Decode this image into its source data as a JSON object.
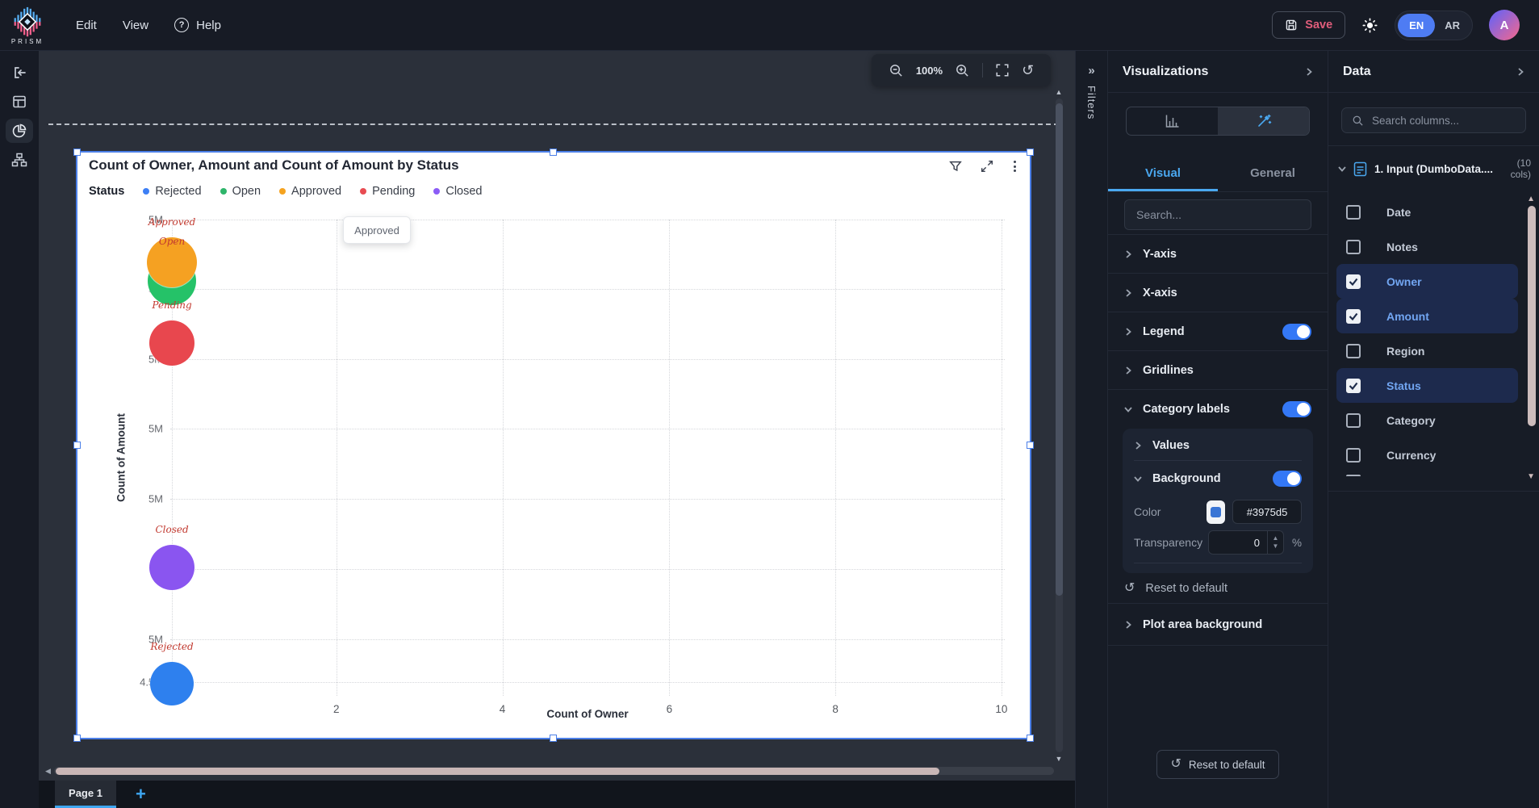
{
  "topbar": {
    "brand": "PRISM",
    "menus": {
      "edit": "Edit",
      "view": "View",
      "help": "Help"
    },
    "save_label": "Save",
    "lang": {
      "en": "EN",
      "ar": "AR"
    },
    "avatar_initial": "A"
  },
  "canvas": {
    "zoom_level": "100%",
    "filters_tab": "Filters",
    "page_tab": "Page 1",
    "add_page": "+",
    "tooltip": "Approved"
  },
  "chart_data": {
    "type": "scatter",
    "title": "Count of Owner, Amount and Count of Amount by Status",
    "xlabel": "Count of Owner",
    "ylabel": "Count of Amount",
    "legend_title": "Status",
    "legend_position": "top",
    "grid": true,
    "x_axis_range": [
      0,
      10
    ],
    "y_axis_range": [
      "4.5M",
      "5.2M"
    ],
    "x_ticks": [
      {
        "label": "",
        "frac": 0.002
      },
      {
        "label": "2",
        "frac": 0.199
      },
      {
        "label": "4",
        "frac": 0.398
      },
      {
        "label": "6",
        "frac": 0.598
      },
      {
        "label": "8",
        "frac": 0.797
      },
      {
        "label": "10",
        "frac": 0.996
      }
    ],
    "y_ticks": [
      {
        "label": "5M",
        "frac": 0.0
      },
      {
        "label": "5M",
        "frac": 0.146
      },
      {
        "label": "5M",
        "frac": 0.293
      },
      {
        "label": "5M",
        "frac": 0.439
      },
      {
        "label": "5M",
        "frac": 0.586
      },
      {
        "label": "",
        "frac": 0.734
      },
      {
        "label": "5M",
        "frac": 0.881
      },
      {
        "label": "4.5M",
        "frac": 0.971
      }
    ],
    "points": [
      {
        "status": "Open",
        "count_of_owner": 0,
        "count_of_amount_M": 5.11,
        "color": "#25c268",
        "fx": 0.002,
        "fy": 0.129,
        "r": 30
      },
      {
        "status": "Approved",
        "count_of_owner": 0,
        "count_of_amount_M": 5.14,
        "color": "#f5a122",
        "fx": 0.002,
        "fy": 0.09,
        "r": 31
      },
      {
        "status": "Pending",
        "count_of_owner": 0,
        "count_of_amount_M": 5.02,
        "color": "#e8474e",
        "fx": 0.002,
        "fy": 0.259,
        "r": 28
      },
      {
        "status": "Closed",
        "count_of_owner": 0,
        "count_of_amount_M": 4.7,
        "color": "#8a55f0",
        "fx": 0.002,
        "fy": 0.731,
        "r": 28
      },
      {
        "status": "Rejected",
        "count_of_owner": 0,
        "count_of_amount_M": 4.54,
        "color": "#2e80ee",
        "fx": 0.002,
        "fy": 0.975,
        "r": 27
      }
    ],
    "legend": [
      {
        "label": "Rejected",
        "color": "#3d7ff5"
      },
      {
        "label": "Open",
        "color": "#2eb56a"
      },
      {
        "label": "Approved",
        "color": "#f5a31f"
      },
      {
        "label": "Pending",
        "color": "#e84c52"
      },
      {
        "label": "Closed",
        "color": "#8b5cf6"
      }
    ],
    "category_label_color": "#c23a30"
  },
  "viz_panel": {
    "title": "Visualizations",
    "tabs": {
      "visual": "Visual",
      "general": "General"
    },
    "search_placeholder": "Search...",
    "sections": [
      "Y-axis",
      "X-axis",
      "Legend",
      "Gridlines",
      "Category labels"
    ],
    "values_label": "Values",
    "background_label": "Background",
    "color_label": "Color",
    "color_value": "#3975d5",
    "color_hex": "#3975d5",
    "transparency_label": "Transparency",
    "transparency_value": "0",
    "percent": "%",
    "reset_link": "Reset to default",
    "plot_area_label": "Plot area background",
    "reset_button": "Reset to default"
  },
  "data_panel": {
    "title": "Data",
    "search_placeholder": "Search columns...",
    "source_label": "1. Input (DumboData....",
    "cols_line1": "(10",
    "cols_line2": "cols)",
    "fields": [
      {
        "name": "Date",
        "checked": false
      },
      {
        "name": "Notes",
        "checked": false
      },
      {
        "name": "Owner",
        "checked": true
      },
      {
        "name": "Amount",
        "checked": true
      },
      {
        "name": "Region",
        "checked": false
      },
      {
        "name": "Status",
        "checked": true
      },
      {
        "name": "Category",
        "checked": false
      },
      {
        "name": "Currency",
        "checked": false
      }
    ]
  }
}
